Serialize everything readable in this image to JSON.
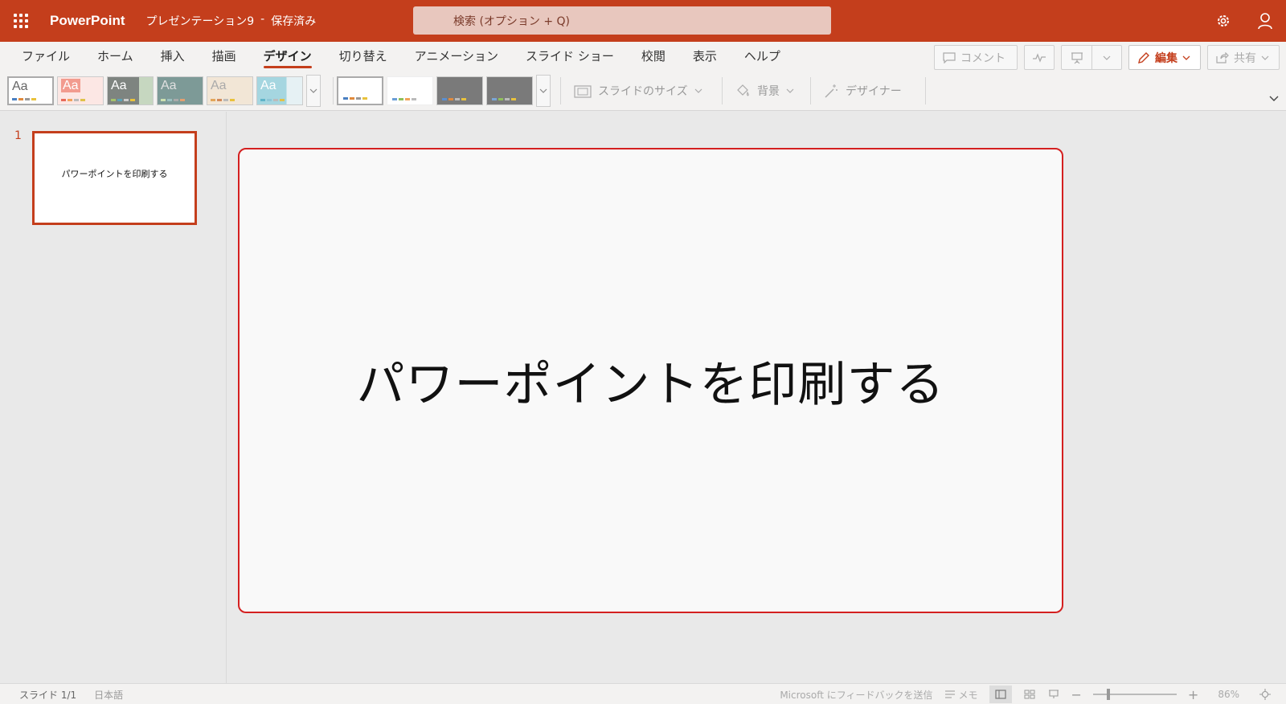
{
  "titlebar": {
    "app_name": "PowerPoint",
    "doc_name": "プレゼンテーション9",
    "separator": "-",
    "save_status": "保存済み",
    "search_placeholder": "検索 (オプション + Q)",
    "accent_color": "#c43e1c"
  },
  "ribbon": {
    "tabs": [
      {
        "label": "ファイル"
      },
      {
        "label": "ホーム"
      },
      {
        "label": "挿入"
      },
      {
        "label": "描画"
      },
      {
        "label": "デザイン",
        "active": true
      },
      {
        "label": "切り替え"
      },
      {
        "label": "アニメーション"
      },
      {
        "label": "スライド ショー"
      },
      {
        "label": "校閲"
      },
      {
        "label": "表示"
      },
      {
        "label": "ヘルプ"
      }
    ],
    "comment_label": "コメント",
    "edit_label": "編集",
    "share_label": "共有",
    "themes": [
      {
        "label": "Aa",
        "bg": "#ffffff",
        "fg": "#555555"
      },
      {
        "label": "Aa",
        "bg": "#f4b6ad",
        "fg": "#ffffff"
      },
      {
        "label": "Aa",
        "bg": "#8a8f8c",
        "fg": "#ffffff"
      },
      {
        "label": "Aa",
        "bg": "#7d9a97",
        "fg": "#e0e0e0"
      },
      {
        "label": "Aa",
        "bg": "#efe0cc",
        "fg": "#999999"
      },
      {
        "label": "Aa",
        "bg": "#a5d6e0",
        "fg": "#ffffff"
      }
    ],
    "slide_size_label": "スライドのサイズ",
    "background_label": "背景",
    "designer_label": "デザイナー"
  },
  "thumbnails": {
    "slide_number": "1",
    "slide_text": "パワーポイントを印刷する"
  },
  "slide": {
    "title": "パワーポイントを印刷する"
  },
  "statusbar": {
    "slide_count": "スライド 1/1",
    "language": "日本語",
    "feedback": "Microsoft にフィードバックを送信",
    "notes_label": "メモ",
    "zoom": "86%"
  }
}
